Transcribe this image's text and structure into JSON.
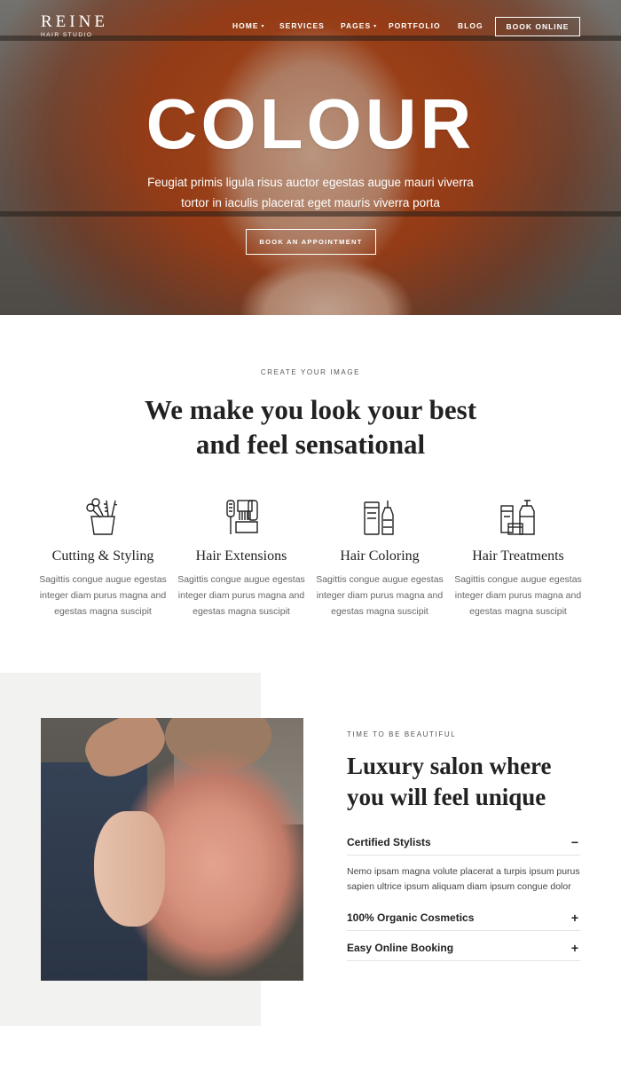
{
  "header": {
    "logo": {
      "name": "REINE",
      "tagline": "HAIR STUDIO"
    },
    "nav": [
      {
        "label": "HOME",
        "has_dropdown": true
      },
      {
        "label": "SERVICES",
        "has_dropdown": false
      },
      {
        "label": "PAGES",
        "has_dropdown": true
      },
      {
        "label": "PORTFOLIO",
        "has_dropdown": false
      },
      {
        "label": "BLOG",
        "has_dropdown": false
      }
    ],
    "book_online": "BOOK ONLINE"
  },
  "hero": {
    "title": "COLOUR",
    "text_line1": "Feugiat primis ligula risus auctor egestas augue mauri viverra",
    "text_line2": "tortor in iaculis placerat eget mauris viverra porta",
    "button": "BOOK AN APPOINTMENT"
  },
  "services_section": {
    "eyebrow": "CREATE YOUR IMAGE",
    "title_line1": "We make you look your best",
    "title_line2": "and feel sensational",
    "items": [
      {
        "icon": "scissors-comb-cup-icon",
        "title": "Cutting & Styling",
        "desc": [
          "Sagittis congue augue egestas",
          "integer diam purus magna and",
          "egestas magna suscipit"
        ]
      },
      {
        "icon": "brushes-comb-icon",
        "title": "Hair Extensions",
        "desc": [
          "Sagittis congue augue egestas",
          "integer diam purus magna and",
          "egestas magna suscipit"
        ]
      },
      {
        "icon": "dye-bottles-icon",
        "title": "Hair Coloring",
        "desc": [
          "Sagittis congue augue egestas",
          "integer diam purus magna and",
          "egestas magna suscipit"
        ]
      },
      {
        "icon": "treatment-products-icon",
        "title": "Hair Treatments",
        "desc": [
          "Sagittis congue augue egestas",
          "integer diam purus magna and",
          "egestas magna suscipit"
        ]
      }
    ]
  },
  "about_section": {
    "eyebrow": "TIME TO BE BEAUTIFUL",
    "title_line1": "Luxury salon where",
    "title_line2": "you will feel unique",
    "accordion": [
      {
        "label": "Certified Stylists",
        "sign": "−",
        "expanded": true,
        "body_line1": "Nemo ipsam magna volute placerat a turpis ipsum purus",
        "body_line2": "sapien ultrice ipsum aliquam diam ipsum congue dolor"
      },
      {
        "label": "100% Organic Cosmetics",
        "sign": "+",
        "expanded": false
      },
      {
        "label": "Easy Online Booking",
        "sign": "+",
        "expanded": false
      }
    ]
  },
  "colors": {
    "text": "#222222",
    "muted": "#666666",
    "panel": "#f2f2f0",
    "hero_hair": "#c4501e"
  }
}
